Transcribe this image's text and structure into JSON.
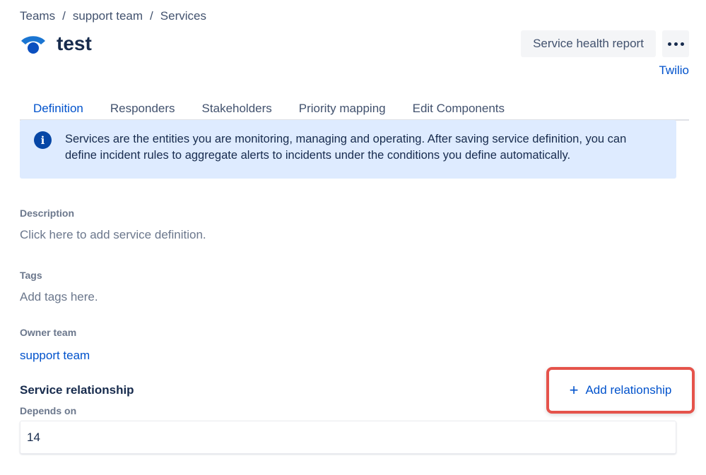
{
  "breadcrumb": {
    "items": [
      "Teams",
      "support team",
      "Services"
    ],
    "separator": "/"
  },
  "header": {
    "title": "test",
    "logo_icon": "service-logo-icon",
    "health_report_label": "Service health report",
    "more_label": "more-actions",
    "integration_link": "Twilio"
  },
  "tabs": [
    {
      "label": "Definition",
      "active": true
    },
    {
      "label": "Responders",
      "active": false
    },
    {
      "label": "Stakeholders",
      "active": false
    },
    {
      "label": "Priority mapping",
      "active": false
    },
    {
      "label": "Edit Components",
      "active": false
    }
  ],
  "info_banner": {
    "icon": "info-icon",
    "line1": "Services are the entities you are monitoring, managing and operating. After saving service definition, you can",
    "line2": "define incident rules to aggregate alerts to incidents under the conditions you define automatically."
  },
  "description": {
    "label": "Description",
    "placeholder": "Click here to add service definition."
  },
  "tags": {
    "label": "Tags",
    "placeholder": "Add tags here."
  },
  "owner_team": {
    "label": "Owner team",
    "value": "support team"
  },
  "service_relationship": {
    "title": "Service relationship",
    "add_label": "Add relationship",
    "depends_on_label": "Depends on",
    "depends_on_value": "14"
  },
  "colors": {
    "accent": "#0052cc",
    "banner_bg": "#deebff",
    "highlight": "#e5534b"
  }
}
